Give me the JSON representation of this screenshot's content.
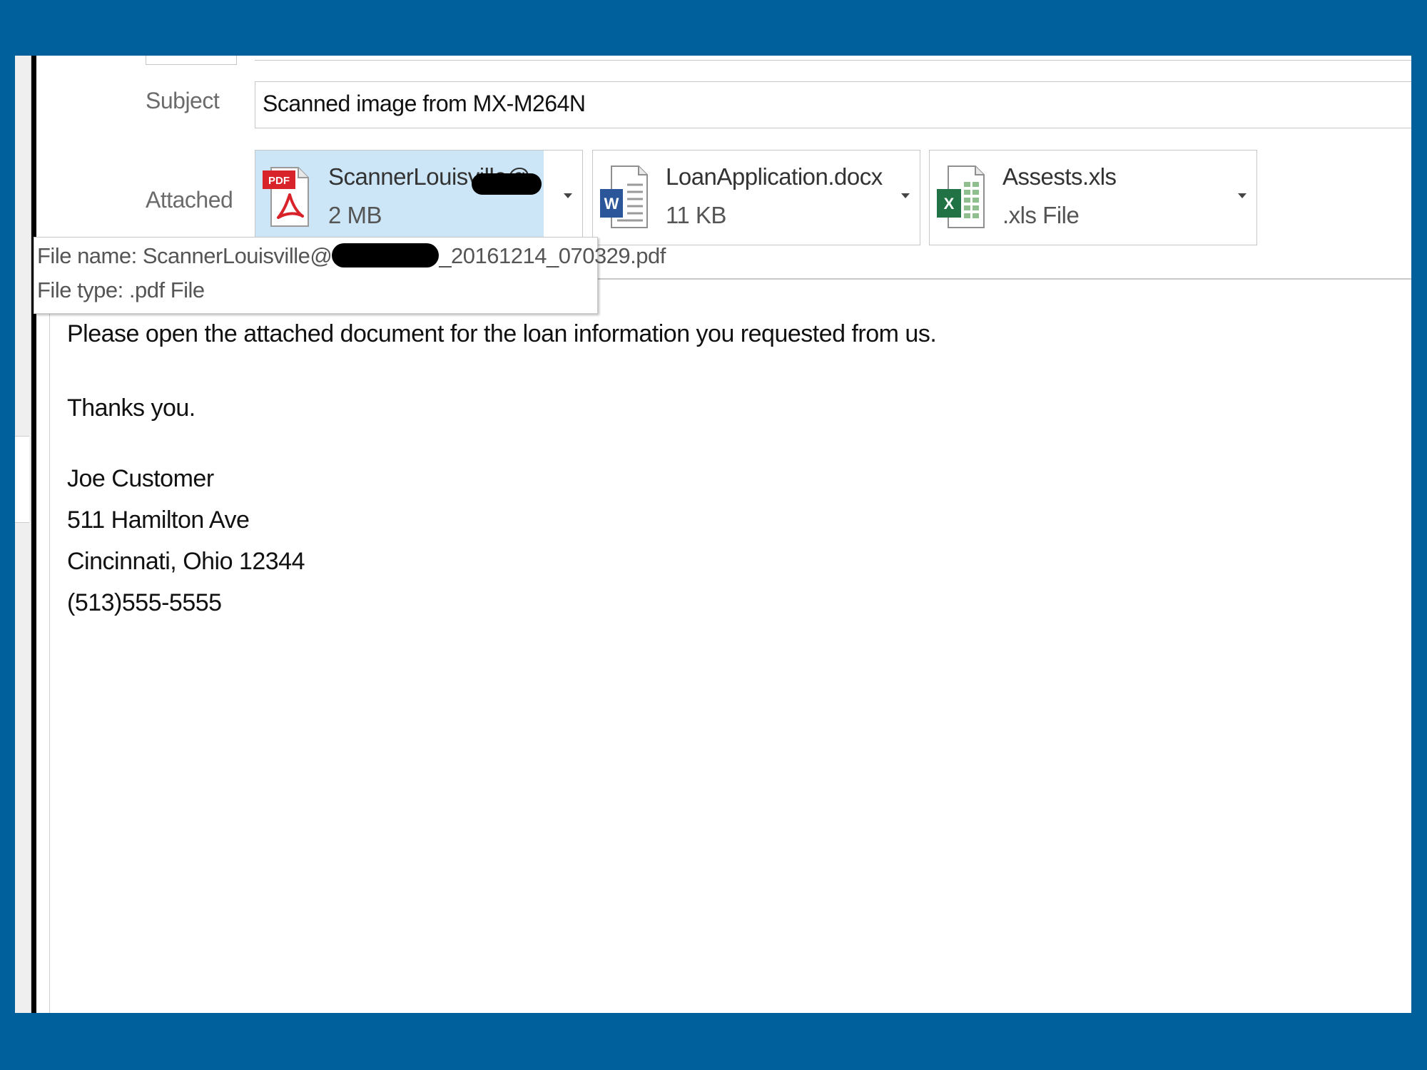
{
  "header": {
    "subject_label": "Subject",
    "subject_value": "Scanned image from MX-M264N",
    "attached_label": "Attached"
  },
  "attachments": [
    {
      "name": "ScannerLouisville@",
      "detail": "2 MB",
      "icon": "pdf-file-icon",
      "icon_badge": "PDF",
      "selected": true,
      "name_redacted": true
    },
    {
      "name": "LoanApplication.docx",
      "detail": "11 KB",
      "icon": "word-file-icon",
      "icon_badge": "W",
      "selected": false
    },
    {
      "name": "Assests.xls",
      "detail": ".xls File",
      "icon": "excel-file-icon",
      "icon_badge": "X",
      "selected": false
    }
  ],
  "tooltip": {
    "file_name_label": "File name:",
    "file_name_prefix": "ScannerLouisville@",
    "file_name_suffix": "_20161214_070329.pdf",
    "file_name_redacted": true,
    "file_type_label": "File type:",
    "file_type_value": ".pdf File"
  },
  "body": {
    "line1": "Please open the attached document for the loan information you requested from us.",
    "line2": "Thanks you.",
    "signature": [
      "Joe Customer",
      "511 Hamilton Ave",
      "Cincinnati, Ohio 12344",
      "(513)555-5555"
    ]
  },
  "colors": {
    "frame": "#00609c",
    "selection": "#cde6f7",
    "pdf_red": "#d8232a",
    "word_blue": "#2b579a",
    "excel_green": "#217346"
  }
}
